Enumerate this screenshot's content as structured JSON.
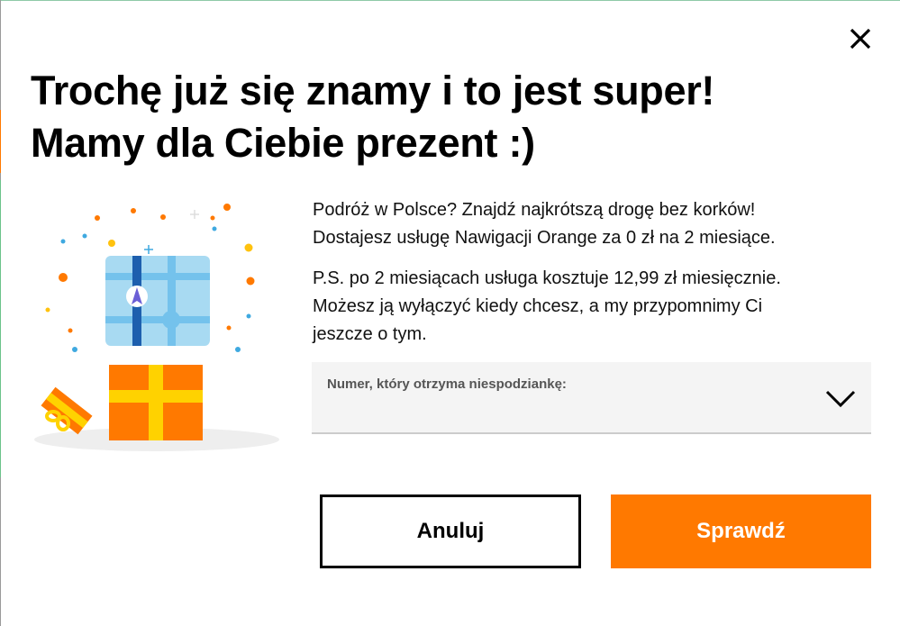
{
  "dialog": {
    "close_icon": "close-icon",
    "title_line1": "Trochę już się znamy i to jest super!",
    "title_line2": "Mamy dla Ciebie prezent :)",
    "illustration_icon": "gift-navigation-map-illustration",
    "description_line1": "Podróż w Polsce? Znajdź najkrótszą drogę bez korków!",
    "description_line2": "Dostajesz usługę Nawigacji Orange za 0 zł na 2 miesiące.",
    "ps_line1": "P.S. po 2 miesiącach usługa kosztuje 12,99 zł miesięcznie.",
    "ps_line2": "Możesz ją wyłączyć kiedy chcesz, a my przypomnimy Ci",
    "ps_line3": "jeszcze o tym.",
    "number_select": {
      "label": "Numer, który otrzyma niespodziankę:",
      "value": "",
      "icon": "chevron-down-icon"
    },
    "cancel_label": "Anuluj",
    "confirm_label": "Sprawdź"
  },
  "colors": {
    "accent": "#ff7900",
    "map_blue": "#a8daf2",
    "road_blue": "#2f7fd0",
    "road_dark": "#1d5fae",
    "gift_ribbon": "#ffd200",
    "select_bg": "#f4f4f4"
  }
}
